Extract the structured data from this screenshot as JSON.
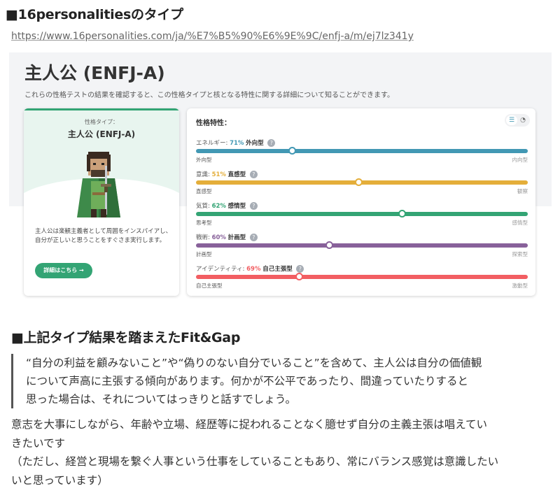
{
  "header_title": "■16personalitiesのタイプ",
  "url": "https://www.16personalities.com/ja/%E7%B5%90%E6%9E%9C/enfj-a/m/ej7lz341y",
  "result": {
    "title": "主人公 (ENFJ-A)",
    "intro": "これらの性格テストの結果を確認すると、この性格タイプと核となる特性に関する詳細について知ることができます。",
    "type_label": "性格タイプ：",
    "type_name": "主人公 (ENFJ-A)",
    "avatar_icon": "protagonist-avatar-icon",
    "description": "主人公は楽観主義者として周囲をインスパイアし、自分が正しいと思うことをすぐさま実行します。",
    "more_button": "詳細はこちら →"
  },
  "traits_panel": {
    "title": "性格特性：",
    "view_icons": [
      "sliders-icon",
      "pie-chart-icon"
    ],
    "traits": [
      {
        "name": "エネルギー:",
        "pct": "71%",
        "dominant": "外向型",
        "left": "外向型",
        "right": "内向型",
        "value": 0.29,
        "color": "#4298b4"
      },
      {
        "name": "意識:",
        "pct": "51%",
        "dominant": "直感型",
        "left": "直感型",
        "right": "観察",
        "value": 0.49,
        "color": "#e4ae3a"
      },
      {
        "name": "気質:",
        "pct": "62%",
        "dominant": "感情型",
        "left": "思考型",
        "right": "感情型",
        "value": 0.62,
        "color": "#33a474"
      },
      {
        "name": "戦術:",
        "pct": "60%",
        "dominant": "計画型",
        "left": "計画型",
        "right": "探索型",
        "value": 0.4,
        "color": "#88619a"
      },
      {
        "name": "アイデンティティ:",
        "pct": "69%",
        "dominant": "自己主張型",
        "left": "自己主張型",
        "right": "激動型",
        "value": 0.31,
        "color": "#f25e62"
      }
    ]
  },
  "section_title": "■上記タイプ結果を踏まえたFit&Gap",
  "quote": [
    "“自分の利益を顧みないこと”や“偽りのない自分でいること”を含めて、主人公は自分の価値観",
    "について声高に主張する傾向があります。何かが不公平であったり、間違っていたりすると",
    "思った場合は、それについてはっきりと話すでしょう。"
  ],
  "body": [
    "意志を大事にしながら、年齢や立場、経歴等に捉われることなく臆せず自分の主義主張は唱えてい",
    "きたいです",
    "（ただし、経営と現場を繋ぐ人事という仕事をしていることもあり、常にバランス感覚は意識したい",
    "いと思っています）"
  ]
}
